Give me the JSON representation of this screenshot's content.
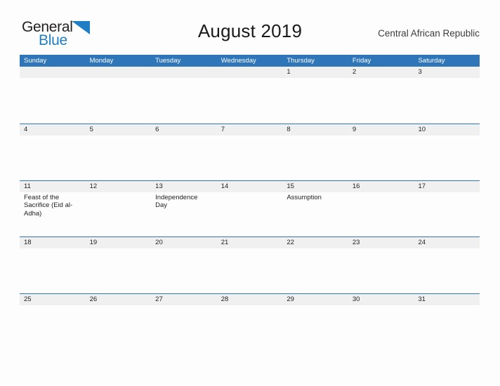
{
  "brand": {
    "name_part1": "General",
    "name_part2": "Blue",
    "flag_icon": "blue-triangle-flag-icon",
    "accent_color": "#1f7ec4"
  },
  "header": {
    "title": "August 2019",
    "locale": "Central African Republic"
  },
  "calendar": {
    "header_color": "#2f76b8",
    "daynum_band_color": "#f0f0f0",
    "weekdays": [
      "Sunday",
      "Monday",
      "Tuesday",
      "Wednesday",
      "Thursday",
      "Friday",
      "Saturday"
    ],
    "weeks": [
      {
        "days": [
          {
            "num": "",
            "events": []
          },
          {
            "num": "",
            "events": []
          },
          {
            "num": "",
            "events": []
          },
          {
            "num": "",
            "events": []
          },
          {
            "num": "1",
            "events": []
          },
          {
            "num": "2",
            "events": []
          },
          {
            "num": "3",
            "events": []
          }
        ]
      },
      {
        "days": [
          {
            "num": "4",
            "events": []
          },
          {
            "num": "5",
            "events": []
          },
          {
            "num": "6",
            "events": []
          },
          {
            "num": "7",
            "events": []
          },
          {
            "num": "8",
            "events": []
          },
          {
            "num": "9",
            "events": []
          },
          {
            "num": "10",
            "events": []
          }
        ]
      },
      {
        "days": [
          {
            "num": "11",
            "events": [
              "Feast of the Sacrifice (Eid al-Adha)"
            ]
          },
          {
            "num": "12",
            "events": []
          },
          {
            "num": "13",
            "events": [
              "Independence Day"
            ]
          },
          {
            "num": "14",
            "events": []
          },
          {
            "num": "15",
            "events": [
              "Assumption"
            ]
          },
          {
            "num": "16",
            "events": []
          },
          {
            "num": "17",
            "events": []
          }
        ]
      },
      {
        "days": [
          {
            "num": "18",
            "events": []
          },
          {
            "num": "19",
            "events": []
          },
          {
            "num": "20",
            "events": []
          },
          {
            "num": "21",
            "events": []
          },
          {
            "num": "22",
            "events": []
          },
          {
            "num": "23",
            "events": []
          },
          {
            "num": "24",
            "events": []
          }
        ]
      },
      {
        "days": [
          {
            "num": "25",
            "events": []
          },
          {
            "num": "26",
            "events": []
          },
          {
            "num": "27",
            "events": []
          },
          {
            "num": "28",
            "events": []
          },
          {
            "num": "29",
            "events": []
          },
          {
            "num": "30",
            "events": []
          },
          {
            "num": "31",
            "events": []
          }
        ]
      }
    ]
  }
}
